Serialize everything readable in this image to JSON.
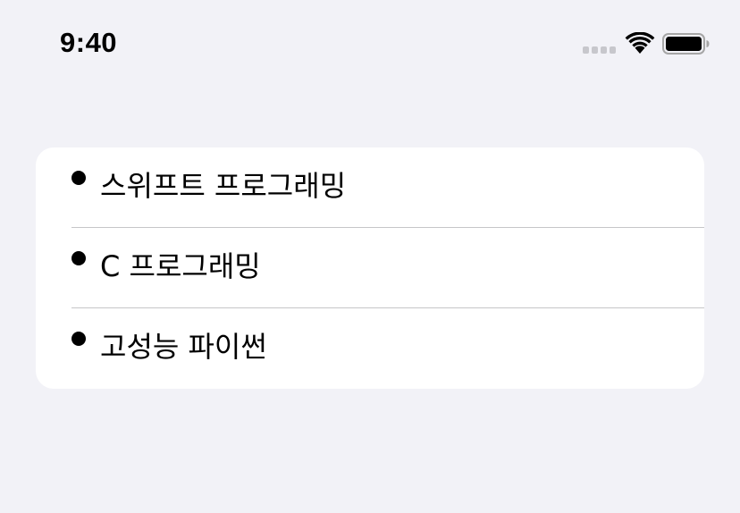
{
  "status_bar": {
    "time": "9:40",
    "signal_icon": "cellular-signal-icon",
    "wifi_icon": "wifi-icon",
    "battery_icon": "battery-icon",
    "battery_level": 1.0
  },
  "list": {
    "items": [
      {
        "label": "스위프트 프로그래밍"
      },
      {
        "label": "C 프로그래밍"
      },
      {
        "label": "고성능 파이썬"
      }
    ]
  }
}
